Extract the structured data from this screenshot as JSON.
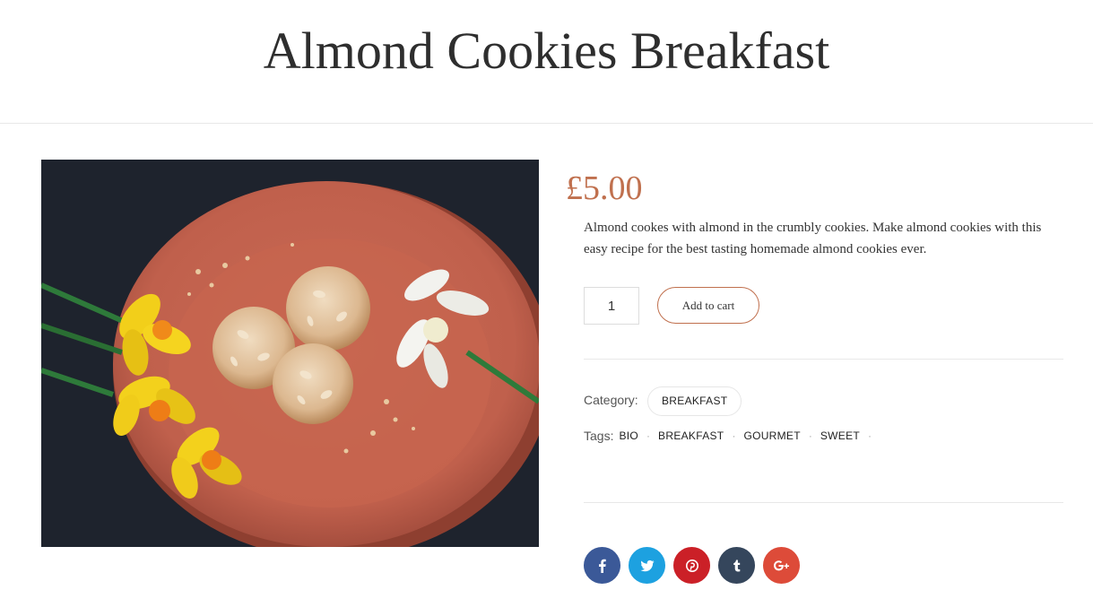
{
  "header": {
    "title": "Almond Cookies Breakfast"
  },
  "product": {
    "image_alt": "Almond cookies on a terracotta plate with daffodils",
    "price": "£5.00",
    "description": "Almond cookes with almond in the crumbly cookies. Make almond cookies with this easy recipe for the best tasting homemade almond cookies ever.",
    "quantity": "1",
    "add_to_cart_label": "Add to cart"
  },
  "meta": {
    "category_label": "Category:",
    "category": "BREAKFAST",
    "tags_label": "Tags:",
    "tags": [
      "BIO",
      "BREAKFAST",
      "GOURMET",
      "SWEET"
    ],
    "tag_separator": "·"
  },
  "social": [
    {
      "name": "facebook",
      "icon": "facebook-icon",
      "glyph": "f",
      "color": "#3b5998"
    },
    {
      "name": "twitter",
      "icon": "twitter-icon",
      "glyph": "t",
      "color": "#1da1e0"
    },
    {
      "name": "pinterest",
      "icon": "pinterest-icon",
      "glyph": "p",
      "color": "#cb2027"
    },
    {
      "name": "tumblr",
      "icon": "tumblr-icon",
      "glyph": "t",
      "color": "#35465c"
    },
    {
      "name": "google-plus",
      "icon": "google-plus-icon",
      "glyph": "G+",
      "color": "#dd4b39"
    }
  ],
  "colors": {
    "accent": "#c0704e",
    "divider": "#e8e8e8"
  }
}
